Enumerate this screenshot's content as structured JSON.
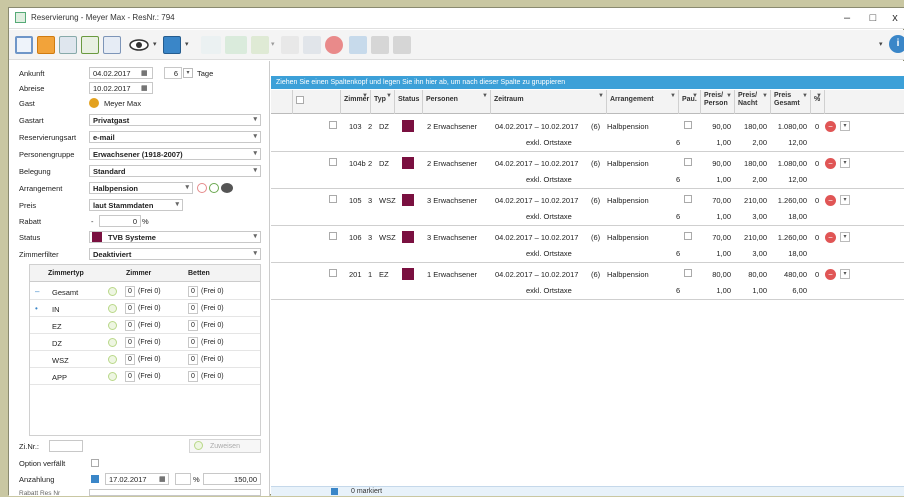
{
  "window": {
    "title": "Reservierung - Meyer Max - ResNr.: 794",
    "btn_min": "–",
    "btn_max": "□",
    "btn_close": "x"
  },
  "left": {
    "ankunft_label": "Ankunft",
    "ankunft_value": "04.02.2017",
    "tage_value": "6",
    "tage_label": "Tage",
    "abreise_label": "Abreise",
    "abreise_value": "10.02.2017",
    "gast_label": "Gast",
    "gast_value": "Meyer Max",
    "gastart_label": "Gastart",
    "gastart_value": "Privatgast",
    "resart_label": "Reservierungsart",
    "resart_value": "e-mail",
    "pgruppe_label": "Personengruppe",
    "pgruppe_value": "Erwachsener (1918-2007)",
    "belegung_label": "Belegung",
    "belegung_value": "Standard",
    "arrangement_label": "Arrangement",
    "arrangement_value": "Halbpension",
    "preis_label": "Preis",
    "preis_value": "laut Stammdaten",
    "rabatt_label": "Rabatt",
    "rabatt_sign": "-",
    "rabatt_value": "0",
    "rabatt_unit": "%",
    "status_label": "Status",
    "status_value": "TVB Systeme",
    "zfilter_label": "Zimmerfilter",
    "zfilter_value": "Deaktiviert",
    "ztable": {
      "headers": [
        "Zimmertyp",
        "Zimmer",
        "Betten"
      ],
      "rows": [
        {
          "prefix": "–",
          "name": "Gesamt",
          "z": "0",
          "zf": "(Frei 0)",
          "b": "0",
          "bf": "(Frei 0)"
        },
        {
          "prefix": "•",
          "name": "IN",
          "z": "0",
          "zf": "(Frei 0)",
          "b": "0",
          "bf": "(Frei 0)"
        },
        {
          "prefix": "",
          "name": "EZ",
          "z": "0",
          "zf": "(Frei 0)",
          "b": "0",
          "bf": "(Frei 0)"
        },
        {
          "prefix": "",
          "name": "DZ",
          "z": "0",
          "zf": "(Frei 0)",
          "b": "0",
          "bf": "(Frei 0)"
        },
        {
          "prefix": "",
          "name": "WSZ",
          "z": "0",
          "zf": "(Frei 0)",
          "b": "0",
          "bf": "(Frei 0)"
        },
        {
          "prefix": "",
          "name": "APP",
          "z": "0",
          "zf": "(Frei 0)",
          "b": "0",
          "bf": "(Frei 0)"
        }
      ]
    },
    "zinr_label": "Zi.Nr.:",
    "zuweisen_label": "Zuweisen",
    "option_label": "Option verfällt",
    "anzahlung_label": "Anzahlung",
    "anzahlung_date": "17.02.2017",
    "anzahlung_pct": "%",
    "anzahlung_amount": "150,00",
    "bottom_label": "Rabatt Res Nr"
  },
  "grid": {
    "group_hint": "Ziehen Sie einen Spaltenkopf und legen Sie ihn hier ab, um nach dieser Spalte zu gruppieren",
    "headers": {
      "zimmer": "Zimmer",
      "typ": "Typ",
      "status": "Status",
      "personen": "Personen",
      "zeitraum": "Zeitraum",
      "arrangement": "Arrangement",
      "pau": "Pau.",
      "pp1": "Preis/",
      "pp2": "Person",
      "pn1": "Preis/",
      "pn2": "Nacht",
      "pg1": "Preis",
      "pg2": "Gesamt",
      "pct": "%"
    },
    "rows": [
      {
        "zimmer": "103",
        "n": "2",
        "typ": "DZ",
        "personen": "2 Erwachsener",
        "zeitraum": "04.02.2017 – 10.02.2017",
        "nights": "(6)",
        "arr": "Halbpension",
        "sub": "exkl. Ortstaxe",
        "qty": "6",
        "pp": "90,00",
        "pn": "180,00",
        "pg": "1.080,00",
        "pct": "0",
        "pp2": "1,00",
        "pn2": "2,00",
        "pg2": "12,00"
      },
      {
        "zimmer": "104b",
        "n": "2",
        "typ": "DZ",
        "personen": "2 Erwachsener",
        "zeitraum": "04.02.2017 – 10.02.2017",
        "nights": "(6)",
        "arr": "Halbpension",
        "sub": "exkl. Ortstaxe",
        "qty": "6",
        "pp": "90,00",
        "pn": "180,00",
        "pg": "1.080,00",
        "pct": "0",
        "pp2": "1,00",
        "pn2": "2,00",
        "pg2": "12,00"
      },
      {
        "zimmer": "105",
        "n": "3",
        "typ": "WSZ",
        "personen": "3 Erwachsener",
        "zeitraum": "04.02.2017 – 10.02.2017",
        "nights": "(6)",
        "arr": "Halbpension",
        "sub": "exkl. Ortstaxe",
        "qty": "6",
        "pp": "70,00",
        "pn": "210,00",
        "pg": "1.260,00",
        "pct": "0",
        "pp2": "1,00",
        "pn2": "3,00",
        "pg2": "18,00"
      },
      {
        "zimmer": "106",
        "n": "3",
        "typ": "WSZ",
        "personen": "3 Erwachsener",
        "zeitraum": "04.02.2017 – 10.02.2017",
        "nights": "(6)",
        "arr": "Halbpension",
        "sub": "exkl. Ortstaxe",
        "qty": "6",
        "pp": "70,00",
        "pn": "210,00",
        "pg": "1.260,00",
        "pct": "0",
        "pp2": "1,00",
        "pn2": "3,00",
        "pg2": "18,00"
      },
      {
        "zimmer": "201",
        "n": "1",
        "typ": "EZ",
        "personen": "1 Erwachsener",
        "zeitraum": "04.02.2017 – 10.02.2017",
        "nights": "(6)",
        "arr": "Halbpension",
        "sub": "exkl. Ortstaxe",
        "qty": "6",
        "pp": "80,00",
        "pn": "80,00",
        "pg": "480,00",
        "pct": "0",
        "pp2": "1,00",
        "pn2": "1,00",
        "pg2": "6,00"
      }
    ],
    "status_text": "0 markiert"
  },
  "colors": {
    "accent": "#3ca0d8",
    "status_swatch": "#7a1040",
    "desktop": "#c9c7a2"
  }
}
